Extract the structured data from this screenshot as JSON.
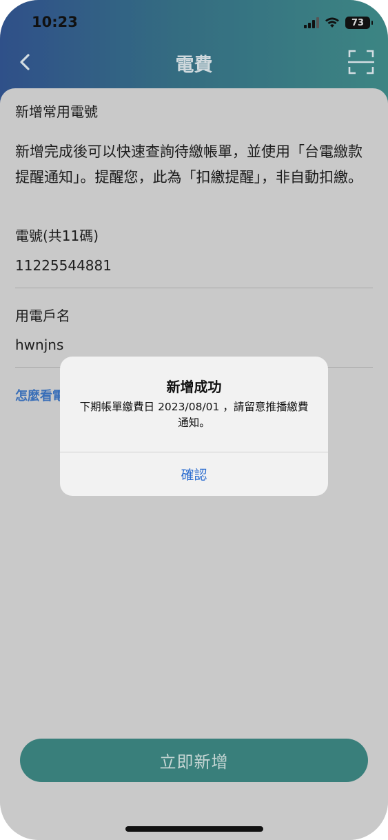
{
  "status_bar": {
    "time": "10:23",
    "battery": "73"
  },
  "nav": {
    "title": "電費",
    "back_icon": "chevron-left-icon",
    "scan_icon": "scan-icon"
  },
  "form": {
    "section_title": "新增常用電號",
    "description": "新增完成後可以快速查詢待繳帳單，並使用「台電繳款提醒通知」。提醒您，此為「扣繳提醒」，非自動扣繳。",
    "account_label": "電號(共11碼)",
    "account_value": "11225544881",
    "name_label": "用電戶名",
    "name_value": "hwnjns",
    "help_link": "怎麼看電",
    "submit_label": "立即新增"
  },
  "alert": {
    "title": "新增成功",
    "message": "下期帳單繳費日 2023/08/01 ，請留意推播繳費通知。",
    "confirm_label": "確認"
  },
  "colors": {
    "button": "#397f7b",
    "link": "#3a6fb8",
    "alert_button": "#2f6fd0"
  }
}
